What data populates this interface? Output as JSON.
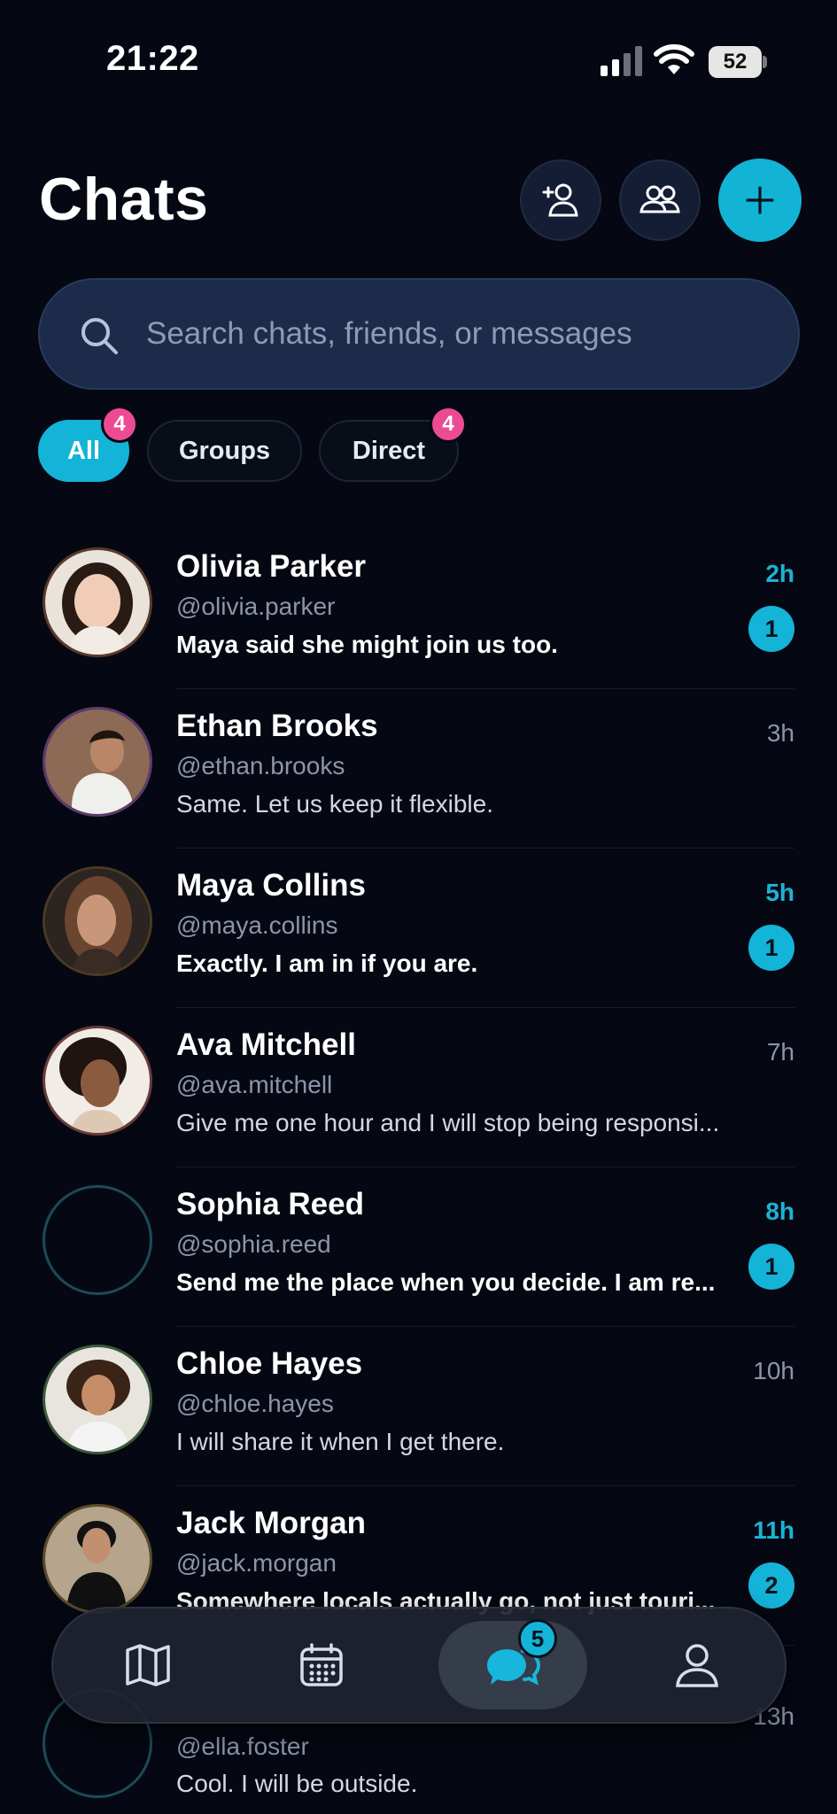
{
  "status_bar": {
    "time": "21:22",
    "battery": "52"
  },
  "header": {
    "title": "Chats"
  },
  "search": {
    "placeholder": "Search chats, friends, or messages"
  },
  "filters": [
    {
      "label": "All",
      "badge": "4",
      "active": true
    },
    {
      "label": "Groups",
      "active": false
    },
    {
      "label": "Direct",
      "badge": "4",
      "active": false
    }
  ],
  "chats": [
    {
      "name": "Olivia Parker",
      "handle": "@olivia.parker",
      "message": "Maya said she might join us too.",
      "time": "2h",
      "unread": "1"
    },
    {
      "name": "Ethan Brooks",
      "handle": "@ethan.brooks",
      "message": "Same. Let us keep it flexible.",
      "time": "3h"
    },
    {
      "name": "Maya Collins",
      "handle": "@maya.collins",
      "message": "Exactly. I am in if you are.",
      "time": "5h",
      "unread": "1"
    },
    {
      "name": "Ava Mitchell",
      "handle": "@ava.mitchell",
      "message": "Give me one hour and I will stop being responsi...",
      "time": "7h"
    },
    {
      "name": "Sophia Reed",
      "handle": "@sophia.reed",
      "message": "Send me the place when you decide. I am re...",
      "time": "8h",
      "unread": "1"
    },
    {
      "name": "Chloe Hayes",
      "handle": "@chloe.hayes",
      "message": "I will share it when I get there.",
      "time": "10h"
    },
    {
      "name": "Jack Morgan",
      "handle": "@jack.morgan",
      "message": "Somewhere locals actually go, not just touri...",
      "time": "11h",
      "unread": "2"
    },
    {
      "name": "",
      "handle": "@ella.foster",
      "message": "Cool. I will be outside.",
      "time": "13h"
    }
  ],
  "bottom_nav": {
    "items": [
      {
        "icon": "map-icon"
      },
      {
        "icon": "calendar-icon"
      },
      {
        "icon": "chat-bubbles-icon",
        "badge": "5",
        "active": true
      },
      {
        "icon": "profile-icon"
      }
    ]
  },
  "colors": {
    "background": "#050812",
    "accent": "#14b3d8",
    "badge_pink": "#ec4b94",
    "search_bg": "#1c2b4a"
  }
}
